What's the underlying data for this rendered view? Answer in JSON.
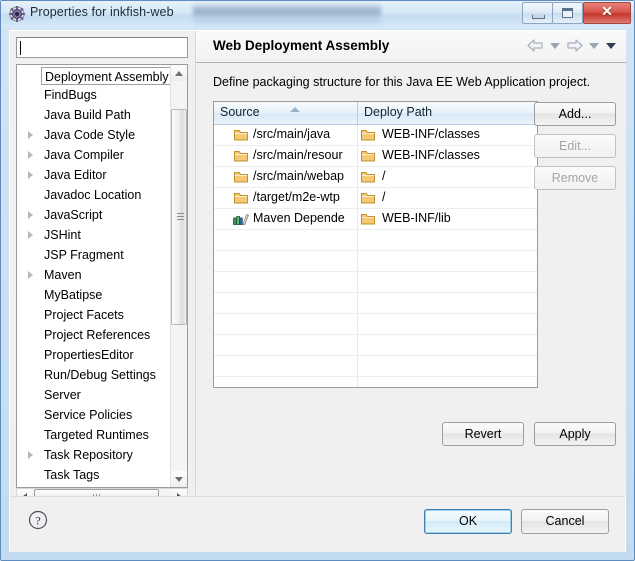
{
  "window": {
    "title": "Properties for inkfish-web",
    "icon": "properties-gear-icon",
    "minimize_label": "Minimize",
    "maximize_label": "Maximize",
    "close_label": "Close",
    "close_glyph": "✕",
    "accent_blue": "#3c7fb1",
    "close_red": "#c3362c"
  },
  "sidebar": {
    "filter": {
      "value": "",
      "placeholder": ""
    },
    "items": [
      {
        "label": "Deployment Assembly",
        "expandable": false,
        "selected": true
      },
      {
        "label": "FindBugs",
        "expandable": false,
        "selected": false
      },
      {
        "label": "Java Build Path",
        "expandable": false,
        "selected": false
      },
      {
        "label": "Java Code Style",
        "expandable": true,
        "selected": false
      },
      {
        "label": "Java Compiler",
        "expandable": true,
        "selected": false
      },
      {
        "label": "Java Editor",
        "expandable": true,
        "selected": false
      },
      {
        "label": "Javadoc Location",
        "expandable": false,
        "selected": false
      },
      {
        "label": "JavaScript",
        "expandable": true,
        "selected": false
      },
      {
        "label": "JSHint",
        "expandable": true,
        "selected": false
      },
      {
        "label": "JSP Fragment",
        "expandable": false,
        "selected": false
      },
      {
        "label": "Maven",
        "expandable": true,
        "selected": false
      },
      {
        "label": "MyBatipse",
        "expandable": false,
        "selected": false
      },
      {
        "label": "Project Facets",
        "expandable": false,
        "selected": false
      },
      {
        "label": "Project References",
        "expandable": false,
        "selected": false
      },
      {
        "label": "PropertiesEditor",
        "expandable": false,
        "selected": false
      },
      {
        "label": "Run/Debug Settings",
        "expandable": false,
        "selected": false
      },
      {
        "label": "Server",
        "expandable": false,
        "selected": false
      },
      {
        "label": "Service Policies",
        "expandable": false,
        "selected": false
      },
      {
        "label": "Targeted Runtimes",
        "expandable": false,
        "selected": false
      },
      {
        "label": "Task Repository",
        "expandable": true,
        "selected": false
      },
      {
        "label": "Task Tags",
        "expandable": false,
        "selected": false
      }
    ]
  },
  "page": {
    "title": "Web Deployment Assembly",
    "description": "Define packaging structure for this Java EE Web Application project.",
    "nav": {
      "back_icon": "back-arrow-icon",
      "back_menu_icon": "chevron-down-icon",
      "forward_icon": "forward-arrow-icon",
      "forward_menu_icon": "chevron-down-icon",
      "menu_icon": "chevron-down-icon"
    }
  },
  "table": {
    "columns": [
      {
        "label": "Source",
        "sorted": "asc"
      },
      {
        "label": "Deploy Path",
        "sorted": "none"
      }
    ],
    "rows": [
      {
        "source": "/src/main/java",
        "source_icon": "folder-icon",
        "deploy": "WEB-INF/classes",
        "deploy_icon": "folder-icon"
      },
      {
        "source": "/src/main/resour",
        "source_icon": "folder-icon",
        "deploy": "WEB-INF/classes",
        "deploy_icon": "folder-icon"
      },
      {
        "source": "/src/main/webap",
        "source_icon": "folder-icon",
        "deploy": "/",
        "deploy_icon": "folder-icon"
      },
      {
        "source": "/target/m2e-wtp",
        "source_icon": "folder-icon",
        "deploy": "/",
        "deploy_icon": "folder-icon"
      },
      {
        "source": "Maven Depende",
        "source_icon": "library-books-icon",
        "deploy": "WEB-INF/lib",
        "deploy_icon": "folder-icon"
      }
    ],
    "empty_row_count": 11
  },
  "buttons": {
    "add": {
      "label": "Add...",
      "enabled": true
    },
    "edit": {
      "label": "Edit...",
      "enabled": false
    },
    "remove": {
      "label": "Remove",
      "enabled": false
    },
    "revert": {
      "label": "Revert",
      "enabled": true
    },
    "apply": {
      "label": "Apply",
      "enabled": true
    },
    "ok": {
      "label": "OK",
      "enabled": true,
      "focused": true
    },
    "cancel": {
      "label": "Cancel",
      "enabled": true
    }
  },
  "footer": {
    "help_icon": "help-question-icon",
    "help_glyph": "?"
  }
}
